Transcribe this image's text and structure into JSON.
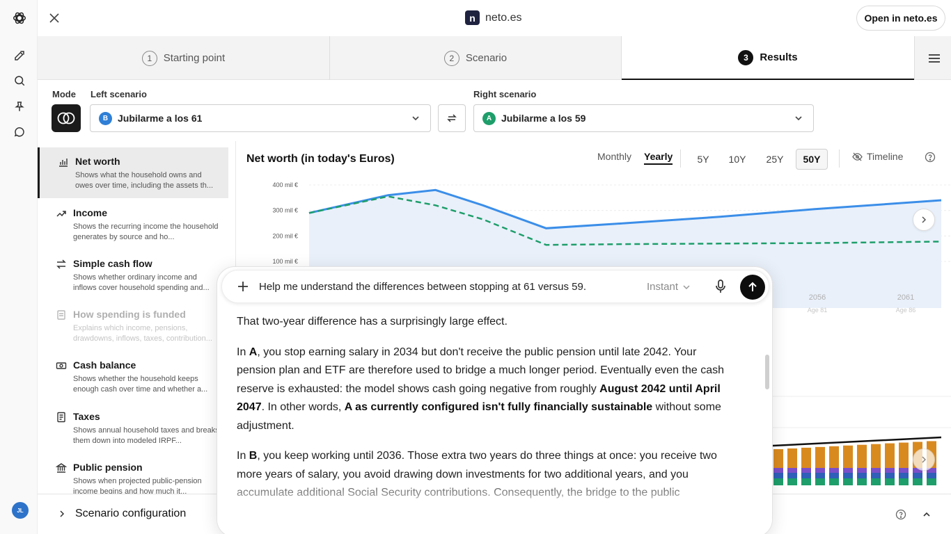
{
  "rail": {
    "icons": [
      "openai-logo-icon",
      "new-chat-icon",
      "search-icon",
      "pin-icon",
      "chat-bubble-icon"
    ],
    "avatar_initials": "JL"
  },
  "topbar": {
    "brand_letter": "n",
    "brand_name": "neto.es",
    "open_button": "Open in neto.es"
  },
  "stepper": {
    "steps": [
      {
        "num": "1",
        "label": "Starting point"
      },
      {
        "num": "2",
        "label": "Scenario"
      },
      {
        "num": "3",
        "label": "Results"
      }
    ]
  },
  "scenario": {
    "mode_label": "Mode",
    "left_label": "Left scenario",
    "right_label": "Right scenario",
    "left": {
      "badge": "B",
      "name": "Jubilarme a los 61",
      "color": "#2f7fd6"
    },
    "right": {
      "badge": "A",
      "name": "Jubilarme a los 59",
      "color": "#1e9e6a"
    }
  },
  "metrics": [
    {
      "title": "Net worth",
      "desc": "Shows what the household owns and owes over time, including the assets th..."
    },
    {
      "title": "Income",
      "desc": "Shows the recurring income the household generates by source and ho..."
    },
    {
      "title": "Simple cash flow",
      "desc": "Shows whether ordinary income and inflows cover household spending and..."
    },
    {
      "title": "How spending is funded",
      "desc": "Explains which income, pensions, drawdowns, inflows, taxes, contribution..."
    },
    {
      "title": "Cash balance",
      "desc": "Shows whether the household keeps enough cash over time and whether a..."
    },
    {
      "title": "Taxes",
      "desc": "Shows annual household taxes and breaks them down into modeled IRPF..."
    },
    {
      "title": "Public pension",
      "desc": "Shows when projected public-pension income begins and how much it..."
    }
  ],
  "chart": {
    "title": "Net worth (in today's Euros)",
    "frequency": [
      "Monthly",
      "Yearly"
    ],
    "ranges": [
      "5Y",
      "10Y",
      "25Y",
      "50Y"
    ],
    "timeline_label": "Timeline",
    "colors": {
      "left": "#3b8ee8",
      "right": "#1e9e6a",
      "fill": "#e9f0fa"
    }
  },
  "chart_data": {
    "type": "line",
    "title": "Net worth (in today's Euros)",
    "y_ticks": [
      "400 mil €",
      "300 mil €",
      "200 mil €",
      "100 mil €"
    ],
    "x_ticks": [
      {
        "year": "2056",
        "age": "Age 81"
      },
      {
        "year": "2061",
        "age": "Age 86"
      }
    ],
    "series": [
      {
        "name": "Jubilarme a los 61",
        "points": [
          [
            2026,
            290
          ],
          [
            2031,
            360
          ],
          [
            2034,
            380
          ],
          [
            2037,
            320
          ],
          [
            2041,
            230
          ],
          [
            2046,
            250
          ],
          [
            2052,
            275
          ],
          [
            2058,
            305
          ],
          [
            2066,
            340
          ]
        ]
      },
      {
        "name": "Jubilarme a los 59",
        "points": [
          [
            2026,
            290
          ],
          [
            2031,
            355
          ],
          [
            2034,
            320
          ],
          [
            2037,
            265
          ],
          [
            2041,
            165
          ],
          [
            2046,
            168
          ],
          [
            2052,
            170
          ],
          [
            2058,
            172
          ],
          [
            2066,
            178
          ]
        ]
      }
    ],
    "ylim": [
      100,
      400
    ]
  },
  "chat": {
    "prompt": "Help me understand the differences between stopping at 61 versus 59.",
    "mode": "Instant",
    "answer": {
      "p1": "That two-year difference has a surprisingly large effect.",
      "p2": {
        "s1": "In ",
        "b1": "A",
        "s2": ", you stop earning salary in 2034 but don't receive the public pension until late 2042. Your pension plan and ETF are therefore used to bridge a much longer period. Eventually even the cash reserve is exhausted: the model shows cash going negative from roughly ",
        "b2": "August 2042 until April 2047",
        "s3": ". In other words, ",
        "b3": "A as currently configured isn't fully financially sustainable",
        "s4": " without some adjustment."
      },
      "p3": {
        "s1": "In ",
        "b1": "B",
        "s2": ", you keep working until 2036. Those extra two years do three things at once: you receive two more years of salary, you avoid drawing down investments for two additional years, and you accumulate additional Social Security contributions. Consequently, the bridge to the public"
      }
    }
  },
  "bottombar": {
    "config_label": "Scenario configuration"
  }
}
